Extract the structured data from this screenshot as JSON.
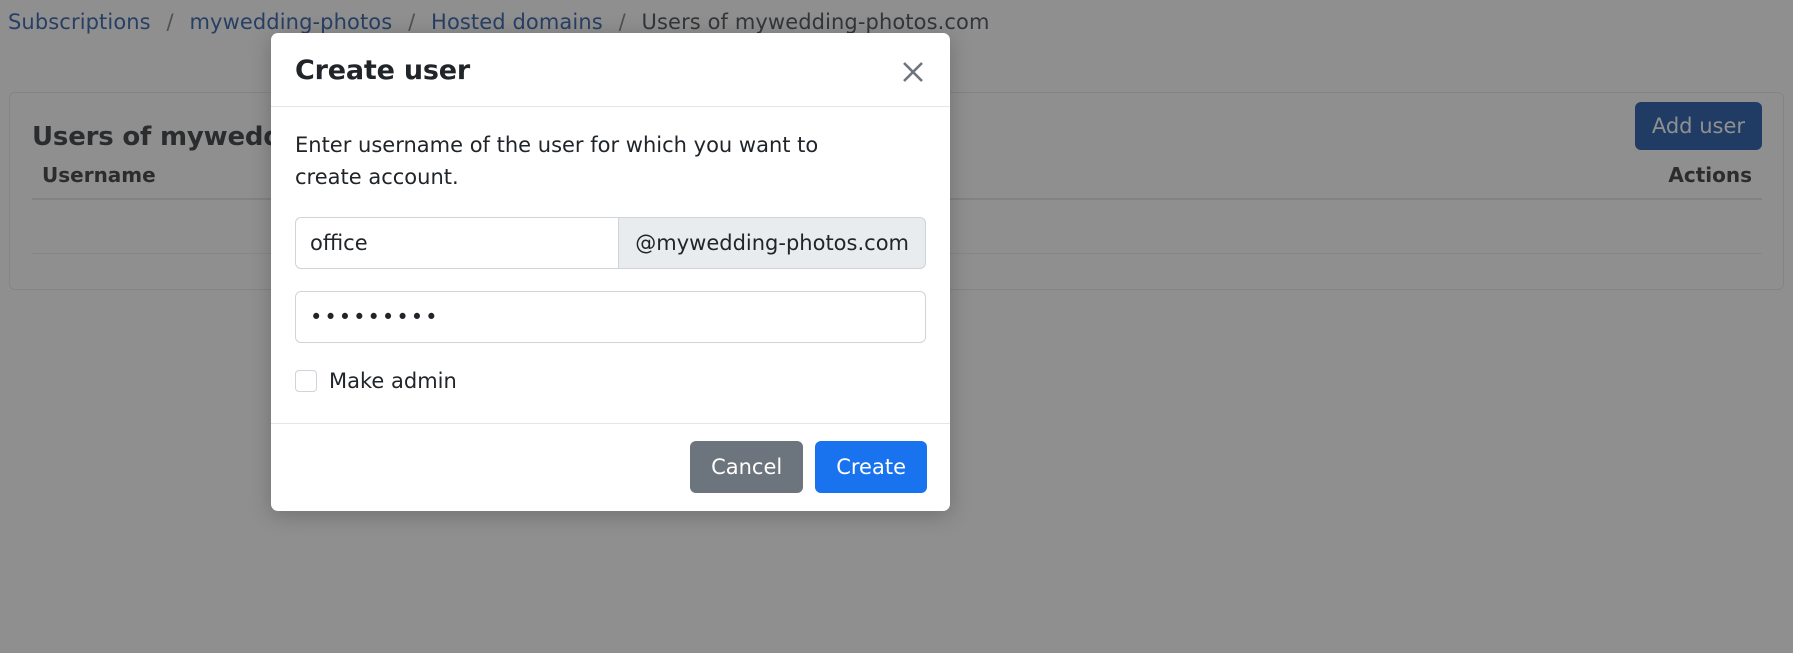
{
  "breadcrumb": {
    "items": [
      {
        "label": "Subscriptions",
        "current": false
      },
      {
        "label": "mywedding-photos",
        "current": false
      },
      {
        "label": "Hosted domains",
        "current": false
      },
      {
        "label": "Users of mywedding-photos.com",
        "current": true
      }
    ],
    "separator": "/"
  },
  "page": {
    "title": "Users of mywedding-photos.com",
    "add_user_label": "Add user",
    "table": {
      "columns": [
        "Username",
        "Actions"
      ],
      "rows": []
    }
  },
  "modal": {
    "title": "Create user",
    "close_icon": "close-icon",
    "description": "Enter username of the user for which you want to create account.",
    "username": {
      "value": "office",
      "placeholder": "",
      "addon": "@mywedding-photos.com"
    },
    "password": {
      "value": "•••••••••",
      "placeholder": ""
    },
    "make_admin": {
      "label": "Make admin",
      "checked": false
    },
    "footer": {
      "cancel_label": "Cancel",
      "create_label": "Create"
    }
  },
  "colors": {
    "link": "#1a4fa0",
    "primary_button": "#0d47a1",
    "create_button": "#1a73ee",
    "cancel_button": "#6c757d",
    "addon_background": "#e9ecef",
    "backdrop": "rgba(51,51,51,0.55)"
  }
}
